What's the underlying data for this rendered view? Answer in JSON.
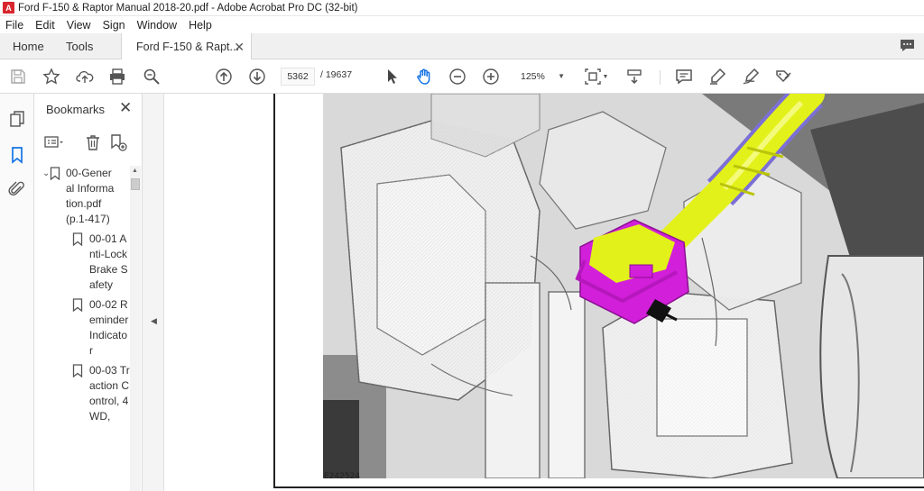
{
  "window": {
    "title": "Ford F-150 & Raptor Manual 2018-20.pdf - Adobe Acrobat Pro DC (32-bit)",
    "app_icon": "pdf-icon"
  },
  "menu": [
    "File",
    "Edit",
    "View",
    "Sign",
    "Window",
    "Help"
  ],
  "tabs": {
    "home": "Home",
    "tools": "Tools",
    "document": "Ford F-150 & Rapt...",
    "close": "✕"
  },
  "toolbar": {
    "current_page": "5362",
    "page_total": "/  19637",
    "zoom": "125%",
    "icons": [
      "save-icon",
      "star-icon",
      "upload-icon",
      "print-icon",
      "zoom-search-icon",
      "arrow-up-icon",
      "arrow-down-icon",
      "select-pointer-icon",
      "hand-icon",
      "zoom-out-icon",
      "zoom-in-icon",
      "page-fit-icon",
      "scroll-mode-icon",
      "comment-icon",
      "highlight-pen-icon",
      "sign-icon",
      "fill-sign-icon"
    ]
  },
  "bookmarks": {
    "title": "Bookmarks",
    "close": "✕",
    "items": [
      {
        "level": 0,
        "caret": "⌄",
        "text": "00-General Information.pdf (p.1-417)"
      },
      {
        "level": 1,
        "caret": "",
        "text": "00-01 Anti-Lock Brake Safety"
      },
      {
        "level": 1,
        "caret": "",
        "text": "00-02 Reminder Indicator"
      },
      {
        "level": 1,
        "caret": "",
        "text": "00-03 Traction Control, 4WD,"
      }
    ]
  },
  "document": {
    "figure_label": "E242524"
  },
  "colors": {
    "accent_blue": "#1473e6",
    "connector_magenta": "#d21fd9",
    "harness_yellow": "#e3f11a",
    "pdf_red": "#d9262e"
  }
}
